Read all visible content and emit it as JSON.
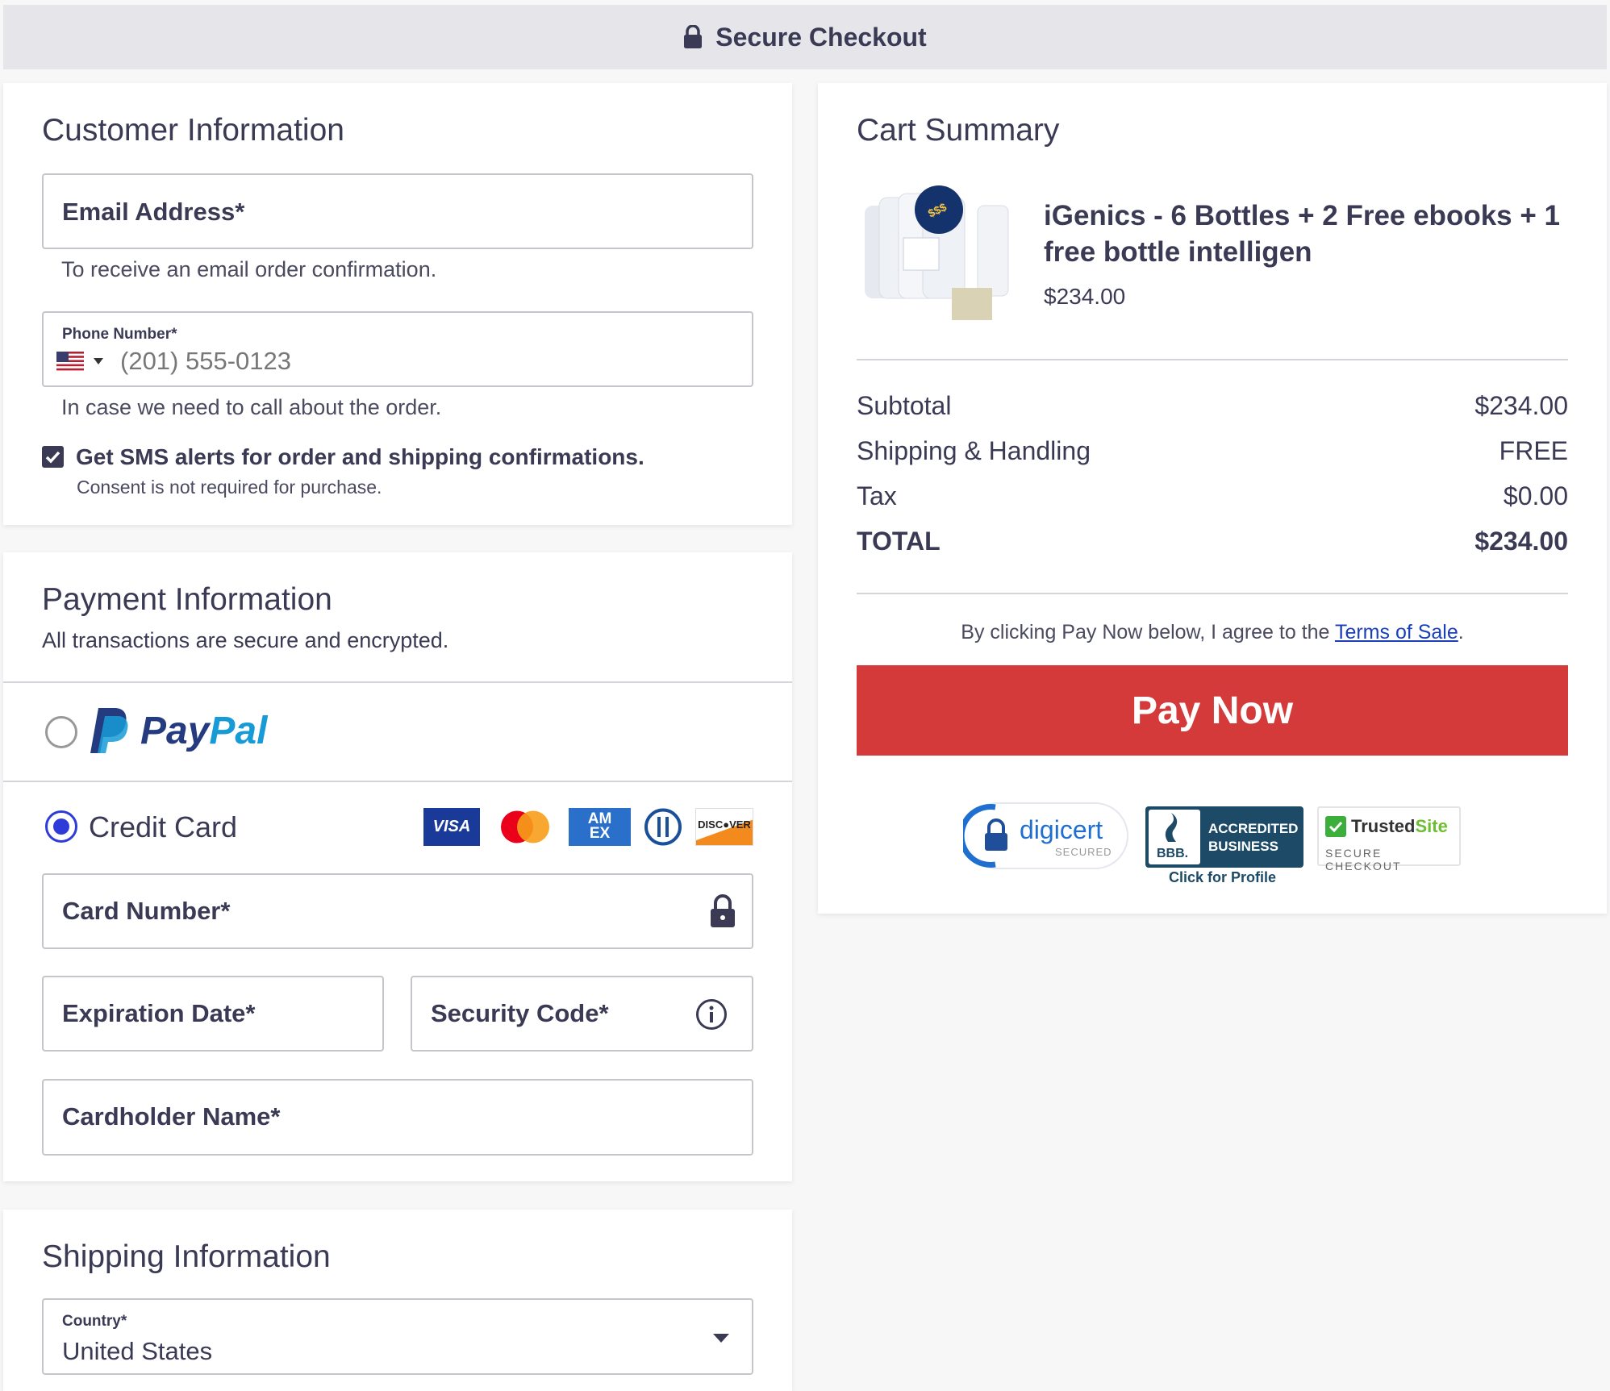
{
  "header": {
    "title": "Secure Checkout",
    "icon": "lock-icon"
  },
  "customer": {
    "heading": "Customer Information",
    "email_label": "Email Address*",
    "email_hint": "To receive an email order confirmation.",
    "phone_label": "Phone Number*",
    "phone_placeholder": "(201) 555-0123",
    "phone_hint": "In case we need to call about the order.",
    "sms_label": "Get SMS alerts for order and shipping confirmations.",
    "sms_sub": "Consent is not required for purchase.",
    "sms_checked": true
  },
  "payment": {
    "heading": "Payment Information",
    "subheading": "All transactions are secure and encrypted.",
    "paypal_label": "PayPal",
    "paypal_pay": "Pay",
    "paypal_pal": "Pal",
    "credit_label": "Credit Card",
    "card_logos": {
      "visa": "VISA",
      "amex_top": "AM",
      "amex_bottom": "EX",
      "discover": "DISC●VER"
    },
    "card_number_label": "Card Number*",
    "expiry_label": "Expiration Date*",
    "cvv_label": "Security Code*",
    "cardholder_label": "Cardholder Name*",
    "selected": "credit_card"
  },
  "shipping": {
    "heading": "Shipping Information",
    "country_label": "Country*",
    "country_value": "United States"
  },
  "cart": {
    "heading": "Cart Summary",
    "product_name": "iGenics - 6 Bottles + 2 Free ebooks + 1 free bottle intelligen",
    "product_price": "$234.00",
    "rows": [
      {
        "label": "Subtotal",
        "value": "$234.00"
      },
      {
        "label": "Shipping & Handling",
        "value": "FREE"
      },
      {
        "label": "Tax",
        "value": "$0.00"
      },
      {
        "label": "TOTAL",
        "value": "$234.00"
      }
    ],
    "terms_prefix": "By clicking Pay Now below, I agree to the ",
    "terms_link": "Terms of Sale",
    "terms_suffix": ".",
    "pay_button": "Pay Now",
    "badges": {
      "digicert": "digicert",
      "digicert_sub": "SECURED",
      "bbb_line1": "ACCREDITED",
      "bbb_line2": "BUSINESS",
      "bbb_mark": "BBB.",
      "bbb_link": "Click for Profile",
      "trusted": "Trusted",
      "trusted_site": "Site",
      "trusted_sub": "SECURE CHECKOUT"
    }
  },
  "colors": {
    "accent": "#2d3bd8",
    "pay_button": "#d43a3a",
    "text": "#3a3a55",
    "paypal_dark": "#253b80",
    "paypal_light": "#179bd7"
  }
}
